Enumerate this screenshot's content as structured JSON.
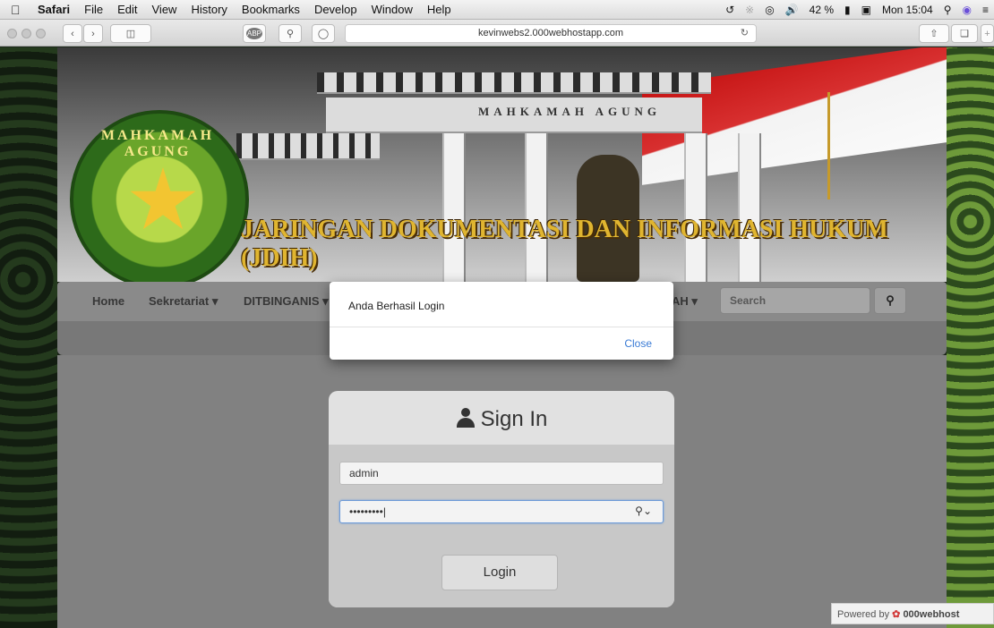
{
  "menubar": {
    "app": "Safari",
    "items": [
      "File",
      "Edit",
      "View",
      "History",
      "Bookmarks",
      "Develop",
      "Window",
      "Help"
    ],
    "battery": "42 %",
    "clock": "Mon 15:04"
  },
  "browser": {
    "url": "kevinwebs2.000webhostapp.com",
    "abp_label": "ABP"
  },
  "banner": {
    "emblem_text": "MAHKAMAH AGUNG",
    "building_text": "MAHKAMAH AGUNG",
    "title": "JARINGAN DOKUMENTASI DAN INFORMASI HUKUM (JDIH)"
  },
  "nav": {
    "home": "Home",
    "sekretariat": "Sekretariat",
    "ditbinganis": "DITBINGANIS",
    "partial": "AH",
    "search_placeholder": "Search"
  },
  "alert": {
    "message": "Anda Berhasil Login",
    "close_label": "Close"
  },
  "signin": {
    "title": "Sign In",
    "username": "admin",
    "password_mask": "•••••••••",
    "login_label": "Login"
  },
  "footer": {
    "powered_prefix": "Powered by",
    "brand": "000webhost"
  },
  "colors": {
    "alert_link": "#3a7bd5",
    "banner_title": "#e0b530"
  }
}
